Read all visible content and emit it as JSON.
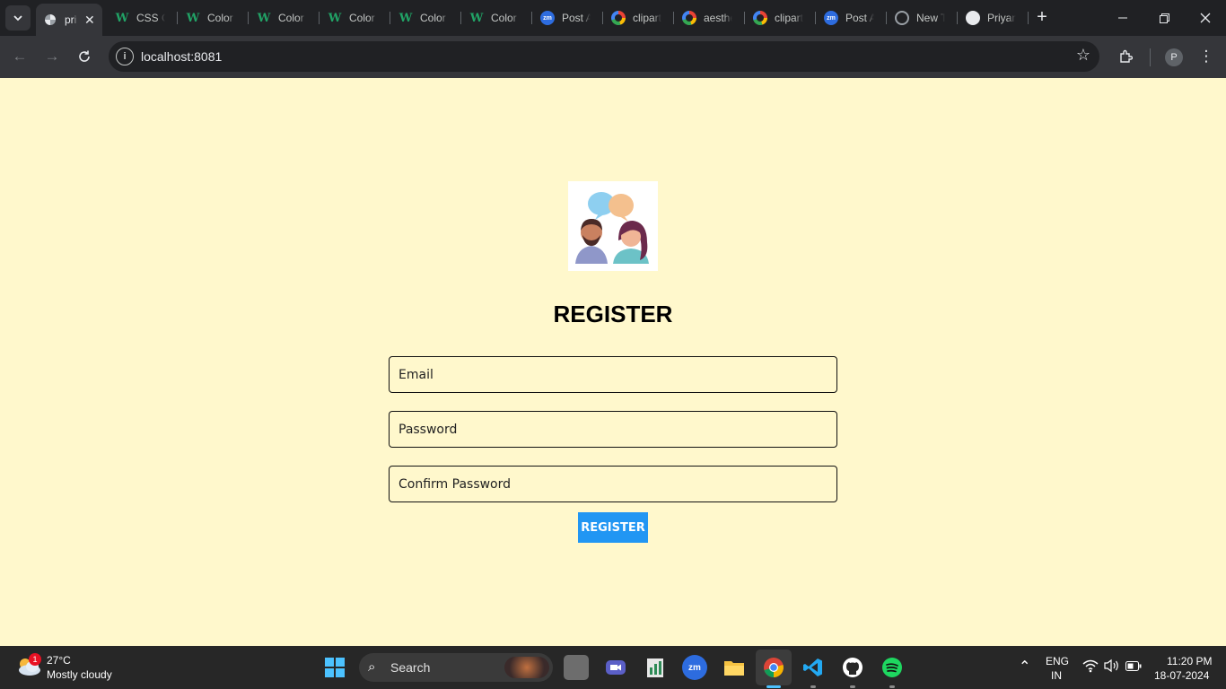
{
  "browser": {
    "tabs": [
      {
        "title": "priyanka",
        "favicon": "pinwheel-icon",
        "active": true
      },
      {
        "title": "CSS Color",
        "favicon": "w-icon"
      },
      {
        "title": "Color",
        "favicon": "w-icon"
      },
      {
        "title": "Color",
        "favicon": "w-icon"
      },
      {
        "title": "Color",
        "favicon": "w-icon"
      },
      {
        "title": "Color",
        "favicon": "w-icon"
      },
      {
        "title": "Color",
        "favicon": "w-icon"
      },
      {
        "title": "Post A",
        "favicon": "zm-icon"
      },
      {
        "title": "clipart",
        "favicon": "google-icon"
      },
      {
        "title": "aesthe",
        "favicon": "google-icon"
      },
      {
        "title": "clipart",
        "favicon": "google-icon"
      },
      {
        "title": "Post A",
        "favicon": "zm-icon"
      },
      {
        "title": "New T",
        "favicon": "chrome-icon"
      },
      {
        "title": "Priyan",
        "favicon": "github-icon"
      }
    ],
    "url": "localhost:8081",
    "profile_initial": "P"
  },
  "page": {
    "title": "REGISTER",
    "email_placeholder": "Email",
    "password_placeholder": "Password",
    "confirm_placeholder": "Confirm Password",
    "button_label": "REGISTER",
    "background": "#fff8cc",
    "button_color": "#2196f3"
  },
  "taskbar": {
    "weather_badge": "1",
    "temperature": "27°C",
    "condition": "Mostly cloudy",
    "search_label": "Search",
    "language": "ENG",
    "region": "IN",
    "time": "11:20 PM",
    "date": "18-07-2024"
  }
}
